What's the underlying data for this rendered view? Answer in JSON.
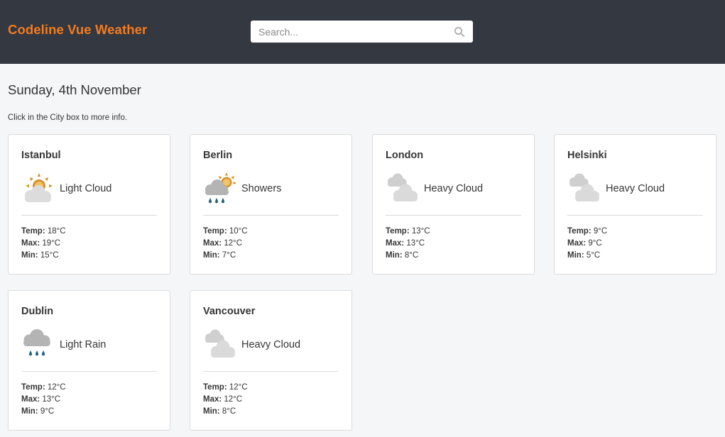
{
  "header": {
    "brand": "Codeline Vue Weather",
    "search_placeholder": "Search...",
    "search_icon": "search-icon"
  },
  "main": {
    "date": "Sunday, 4th November",
    "hint": "Click in the City box to more info."
  },
  "stat_labels": {
    "temp": "Temp:",
    "max": "Max:",
    "min": "Min:"
  },
  "cities": [
    {
      "name": "Istanbul",
      "condition": "Light Cloud",
      "icon": "light-cloud-icon",
      "temp": "18°C",
      "max": "19°C",
      "min": "15°C"
    },
    {
      "name": "Berlin",
      "condition": "Showers",
      "icon": "showers-icon",
      "temp": "10°C",
      "max": "12°C",
      "min": "7°C"
    },
    {
      "name": "London",
      "condition": "Heavy Cloud",
      "icon": "heavy-cloud-icon",
      "temp": "13°C",
      "max": "13°C",
      "min": "8°C"
    },
    {
      "name": "Helsinki",
      "condition": "Heavy Cloud",
      "icon": "heavy-cloud-icon",
      "temp": "9°C",
      "max": "9°C",
      "min": "5°C"
    },
    {
      "name": "Dublin",
      "condition": "Light Rain",
      "icon": "light-rain-icon",
      "temp": "12°C",
      "max": "13°C",
      "min": "9°C"
    },
    {
      "name": "Vancouver",
      "condition": "Heavy Cloud",
      "icon": "heavy-cloud-icon",
      "temp": "12°C",
      "max": "12°C",
      "min": "8°C"
    }
  ],
  "colors": {
    "header_bg": "#343840",
    "brand": "#f47c20",
    "page_bg": "#f5f6f8",
    "sun": "#d4922a",
    "cloud": "#d6d6d6",
    "rain_cloud": "#b4b4b4",
    "rain": "#1e5f7a"
  }
}
